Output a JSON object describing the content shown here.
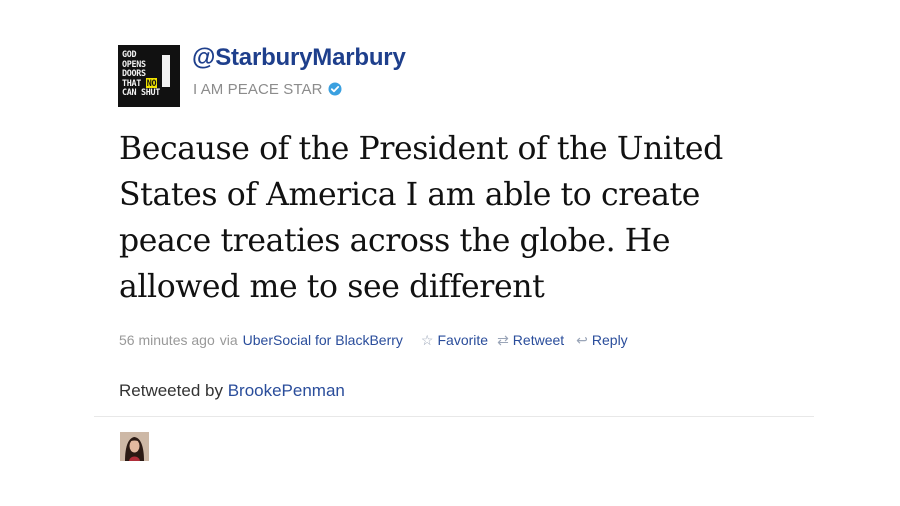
{
  "tweet": {
    "avatar_text": [
      "GOD",
      "OPENS",
      "DOORS",
      "THAT NO",
      "CAN SHUT"
    ],
    "avatar_text_highlight": "NO",
    "handle": "@StarburyMarbury",
    "bio": "I AM PEACE STAR",
    "verified_icon": "verified-check-icon",
    "text": "Because of the President of the United States of America I am able to create peace treaties across the globe. He allowed me to see different",
    "time": "56 minutes ago",
    "via_label": "via",
    "source": "UberSocial for BlackBerry",
    "actions": {
      "favorite": "Favorite",
      "retweet": "Retweet",
      "reply": "Reply"
    }
  },
  "retweeted_by": {
    "label": "Retweeted by",
    "user": "BrookePenman"
  },
  "colors": {
    "handle": "#1e3f8c",
    "link": "#2a4d9b",
    "muted": "#999999",
    "verified": "#3aa0e0"
  }
}
